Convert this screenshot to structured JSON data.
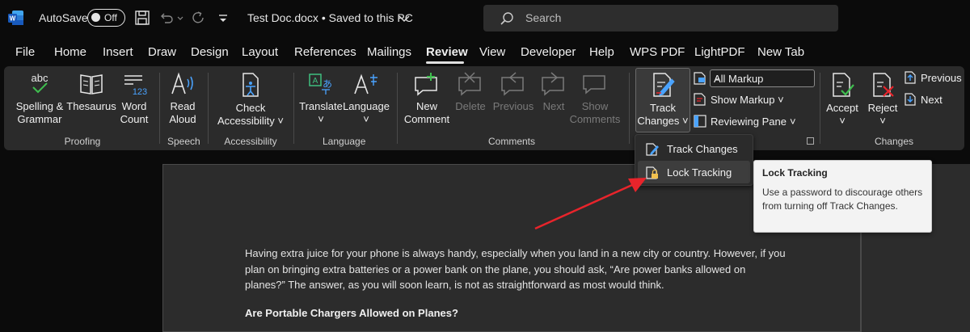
{
  "titlebar": {
    "autosave_label": "AutoSave",
    "autosave_state": "Off",
    "document_title": "Test Doc.docx • Saved to this PC",
    "search_placeholder": "Search"
  },
  "tabs": [
    "File",
    "Home",
    "Insert",
    "Draw",
    "Design",
    "Layout",
    "References",
    "Mailings",
    "Review",
    "View",
    "Developer",
    "Help",
    "WPS PDF",
    "LightPDF",
    "New Tab"
  ],
  "active_tab": "Review",
  "ribbon": {
    "proofing": {
      "label": "Proofing",
      "spelling": [
        "Spelling &",
        "Grammar"
      ],
      "thesaurus": "Thesaurus",
      "word_count": [
        "Word",
        "Count"
      ],
      "abc": "abc",
      "count_digits": "123"
    },
    "speech": {
      "label": "Speech",
      "read_aloud": [
        "Read",
        "Aloud"
      ]
    },
    "accessibility": {
      "label": "Accessibility",
      "check": [
        "Check",
        "Accessibility ˅"
      ]
    },
    "language": {
      "label": "Language",
      "translate": "Translate",
      "language": "Language"
    },
    "comments": {
      "label": "Comments",
      "new_comment": [
        "New",
        "Comment"
      ],
      "delete": "Delete",
      "previous": "Previous",
      "next": "Next",
      "show_comments": [
        "Show",
        "Comments"
      ]
    },
    "tracking": {
      "track_changes": [
        "Track",
        "Changes ˅"
      ],
      "markup_select": "All Markup",
      "show_markup": "Show Markup ˅",
      "reviewing_pane": "Reviewing Pane",
      "reviewing_pane_chevron": "˅"
    },
    "changes": {
      "label": "Changes",
      "accept": "Accept",
      "reject": "Reject",
      "previous": "Previous",
      "next": "Next"
    }
  },
  "menu": {
    "items": [
      {
        "label": "Track Changes"
      },
      {
        "label": "Lock Tracking"
      }
    ]
  },
  "tooltip": {
    "title": "Lock Tracking",
    "body": "Use a password to discourage others from turning off Track Changes."
  },
  "document": {
    "paragraph_lines": [
      "Having extra juice for your phone is always handy, especially when you land in a new city or country. However, if you",
      "plan on bringing extra batteries or a power bank on the plane, you should ask, “Are power banks allowed on",
      "planes?” The answer, as you will soon learn, is not as straightforward as most would think."
    ],
    "heading": "Are Portable Chargers Allowed on Planes?"
  },
  "colors": {
    "accent_red": "#e8242b",
    "word_blue": "#2b7cd3",
    "ribbon_bg": "#2b2b2b",
    "page_bg": "#2c2c2c"
  }
}
